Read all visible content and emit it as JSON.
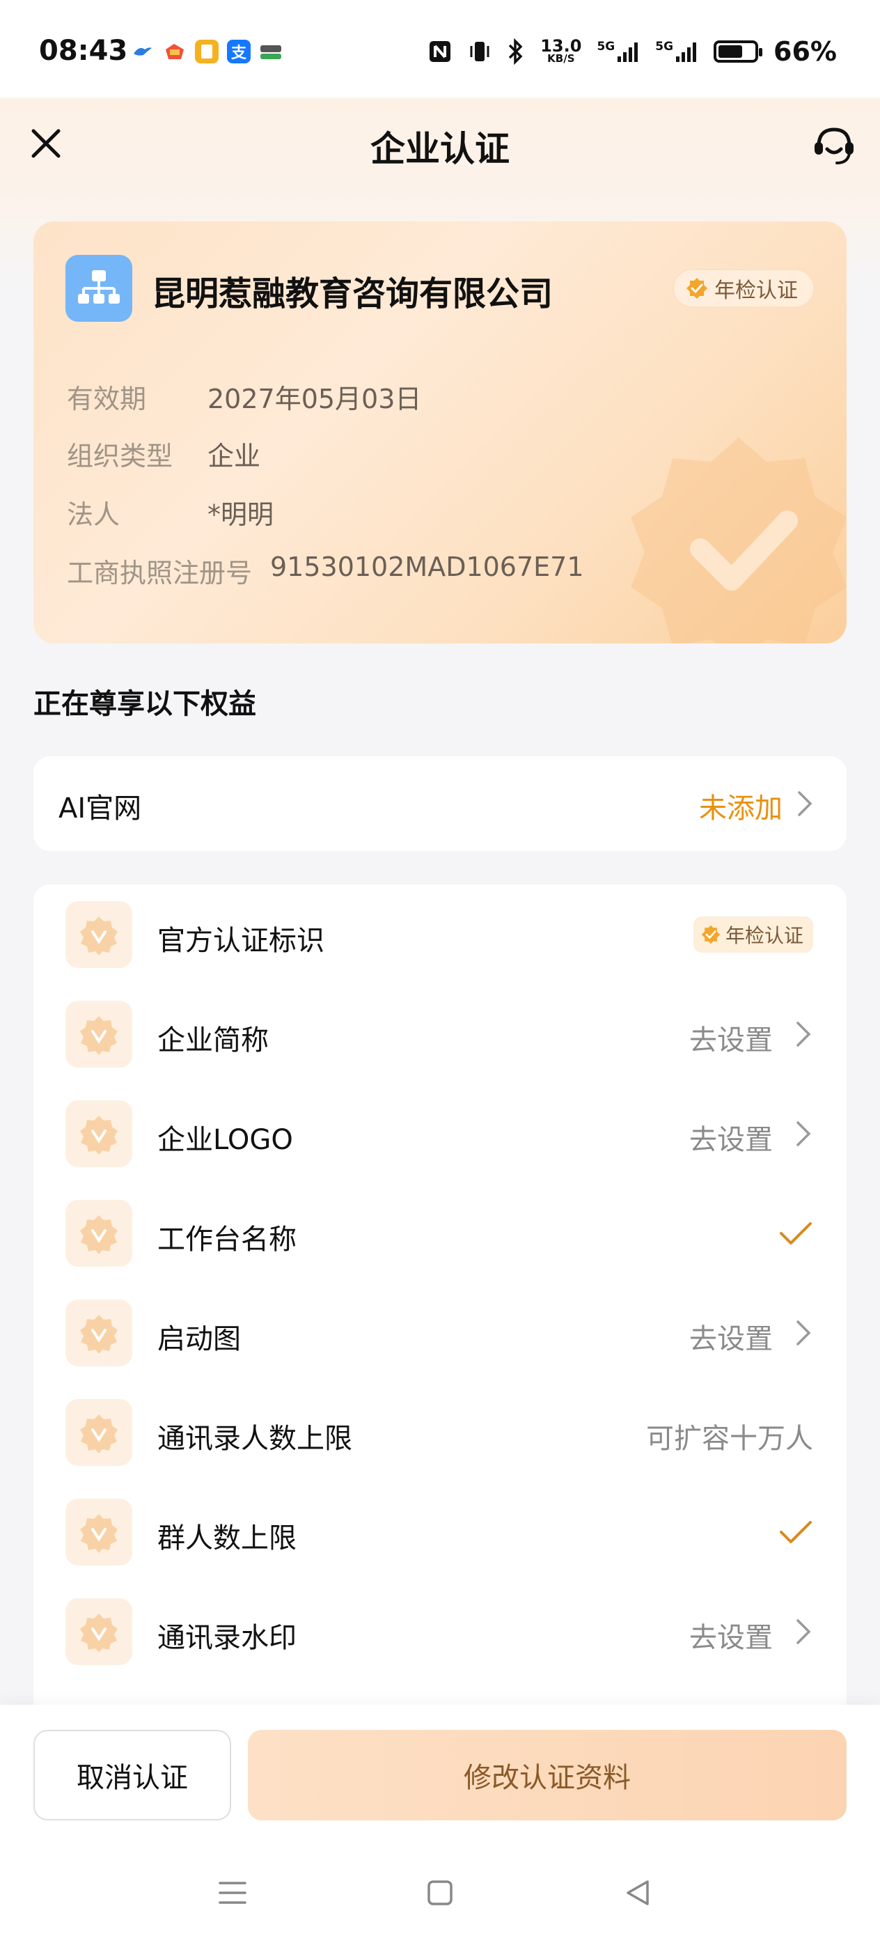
{
  "status_bar": {
    "time": "08:43",
    "net_speed_value": "13.0",
    "net_speed_unit": "KB/S",
    "signal1_label": "5G",
    "signal2_label": "5G",
    "battery_percent": "66%",
    "icons": [
      "nfc-icon",
      "vibrate-icon",
      "bluetooth-icon",
      "signal-icon",
      "signal-icon",
      "battery-icon"
    ],
    "app_icons": [
      "bird-app-icon",
      "game-app-icon",
      "notes-app-icon",
      "alipay-app-icon",
      "oppo-app-icon"
    ]
  },
  "nav": {
    "title": "企业认证",
    "close_icon": "close-icon",
    "service_icon": "customer-service-icon"
  },
  "company": {
    "name": "昆明惹融教育咨询有限公司",
    "badge": "年检认证",
    "fields": [
      {
        "label": "有效期",
        "value": "2027年05月03日"
      },
      {
        "label": "组织类型",
        "value": "企业"
      },
      {
        "label": "法人",
        "value": "*明明"
      },
      {
        "label": "工商执照注册号",
        "value": "91530102MAD1067E71"
      }
    ]
  },
  "section_title": "正在尊享以下权益",
  "ai_site": {
    "label": "AI官网",
    "status": "未添加"
  },
  "benefits": [
    {
      "label": "官方认证标识",
      "type": "badge",
      "value": "年检认证"
    },
    {
      "label": "企业简称",
      "type": "action",
      "value": "去设置"
    },
    {
      "label": "企业LOGO",
      "type": "action",
      "value": "去设置"
    },
    {
      "label": "工作台名称",
      "type": "check",
      "value": ""
    },
    {
      "label": "启动图",
      "type": "action",
      "value": "去设置"
    },
    {
      "label": "通讯录人数上限",
      "type": "text",
      "value": "可扩容十万人"
    },
    {
      "label": "群人数上限",
      "type": "check",
      "value": ""
    },
    {
      "label": "通讯录水印",
      "type": "action",
      "value": "去设置"
    }
  ],
  "bottom": {
    "cancel_label": "取消认证",
    "modify_label": "修改认证资料"
  },
  "colors": {
    "accent_orange": "#e8910e",
    "badge_orange": "#f4a52c",
    "logo_blue": "#74b6f7"
  }
}
